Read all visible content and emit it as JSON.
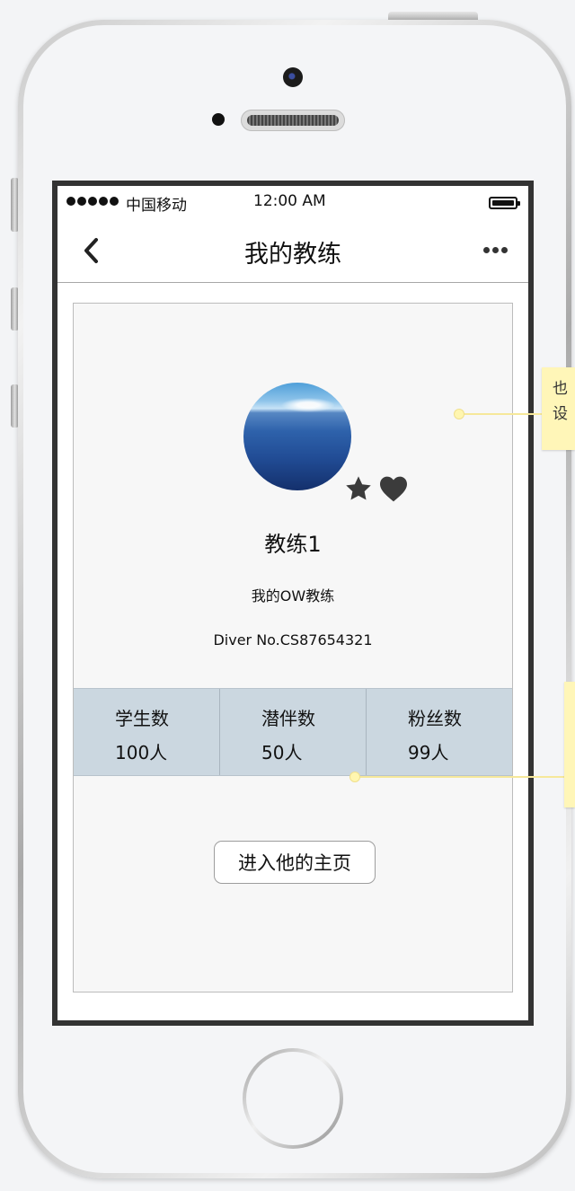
{
  "status_bar": {
    "carrier": "中国移动",
    "time": "12:00 AM"
  },
  "nav": {
    "title": "我的教练",
    "back_icon": "chevron-left-icon",
    "more_icon": "ellipsis-icon"
  },
  "profile": {
    "name": "教练1",
    "description": "我的OW教练",
    "diver_no": "Diver No.CS87654321",
    "badges": [
      "star-icon",
      "heart-icon"
    ]
  },
  "stats": [
    {
      "label": "学生数",
      "value": "100人"
    },
    {
      "label": "潜伴数",
      "value": "50人"
    },
    {
      "label": "粉丝数",
      "value": "99人"
    }
  ],
  "actions": {
    "homepage_button": "进入他的主页"
  },
  "annotations": {
    "note1_text": "也\n设"
  },
  "colors": {
    "stats_background": "#cbd7e0",
    "card_background": "#f7f7f7",
    "note_background": "#fff6b8"
  }
}
